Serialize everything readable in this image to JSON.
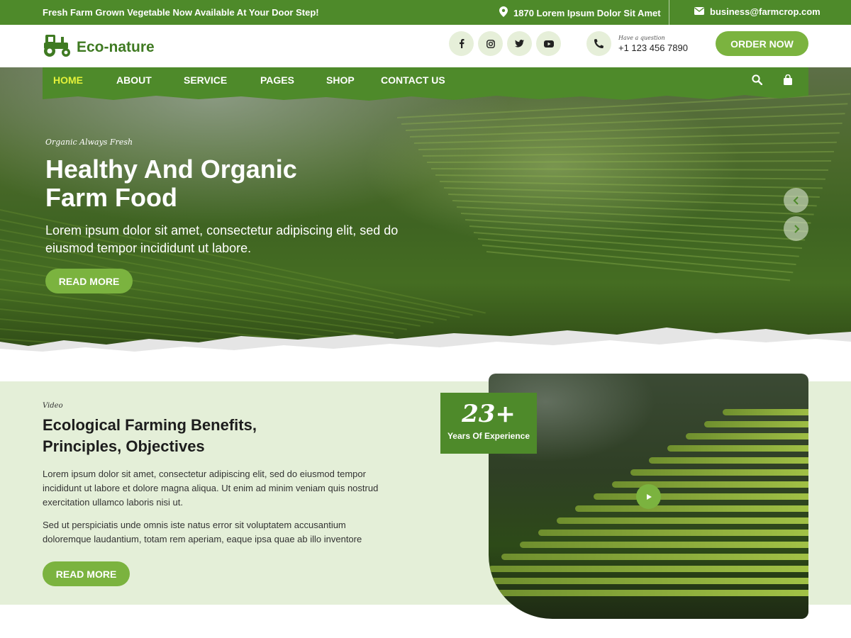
{
  "topbar": {
    "tagline": "Fresh Farm Grown Vegetable Now Available At Your Door Step!",
    "address": "1870 Lorem Ipsum Dolor Sit Amet",
    "email": "business@farmcrop.com"
  },
  "header": {
    "logo_text": "Eco-nature",
    "socials": [
      "facebook-icon",
      "instagram-icon",
      "twitter-icon",
      "youtube-icon"
    ],
    "phone_label": "Have a question",
    "phone_number": "+1 123 456 7890",
    "order_button": "ORDER NOW"
  },
  "nav": {
    "items": [
      {
        "label": "HOME",
        "active": true
      },
      {
        "label": "ABOUT"
      },
      {
        "label": "SERVICE"
      },
      {
        "label": "PAGES"
      },
      {
        "label": "SHOP"
      },
      {
        "label": "CONTACT US"
      }
    ]
  },
  "hero": {
    "subtitle": "Organic Always Fresh",
    "title": "Healthy And Organic Farm Food",
    "text": "Lorem ipsum dolor sit amet, consectetur adipiscing elit, sed do eiusmod tempor incididunt ut labore.",
    "button": "READ MORE"
  },
  "about": {
    "small": "Video",
    "title": "Ecological Farming Benefits, Principles, Objectives",
    "paragraph1": "Lorem ipsum dolor sit amet, consectetur adipiscing elit, sed do eiusmod tempor incididunt ut labore et dolore magna aliqua. Ut enim ad minim veniam quis nostrud exercitation ullamco laboris nisi ut.",
    "paragraph2": "Sed ut perspiciatis unde omnis iste natus error sit voluptatem accusantium doloremque laudantium, totam rem aperiam, eaque ipsa quae ab illo inventore",
    "button": "READ MORE",
    "experience_number": "23+",
    "experience_label": "Years Of Experience"
  },
  "colors": {
    "brand_green": "#4e8a2a",
    "button_green": "#7bb33f",
    "light_green": "#e4efd8",
    "active_nav": "#e4f23a"
  }
}
